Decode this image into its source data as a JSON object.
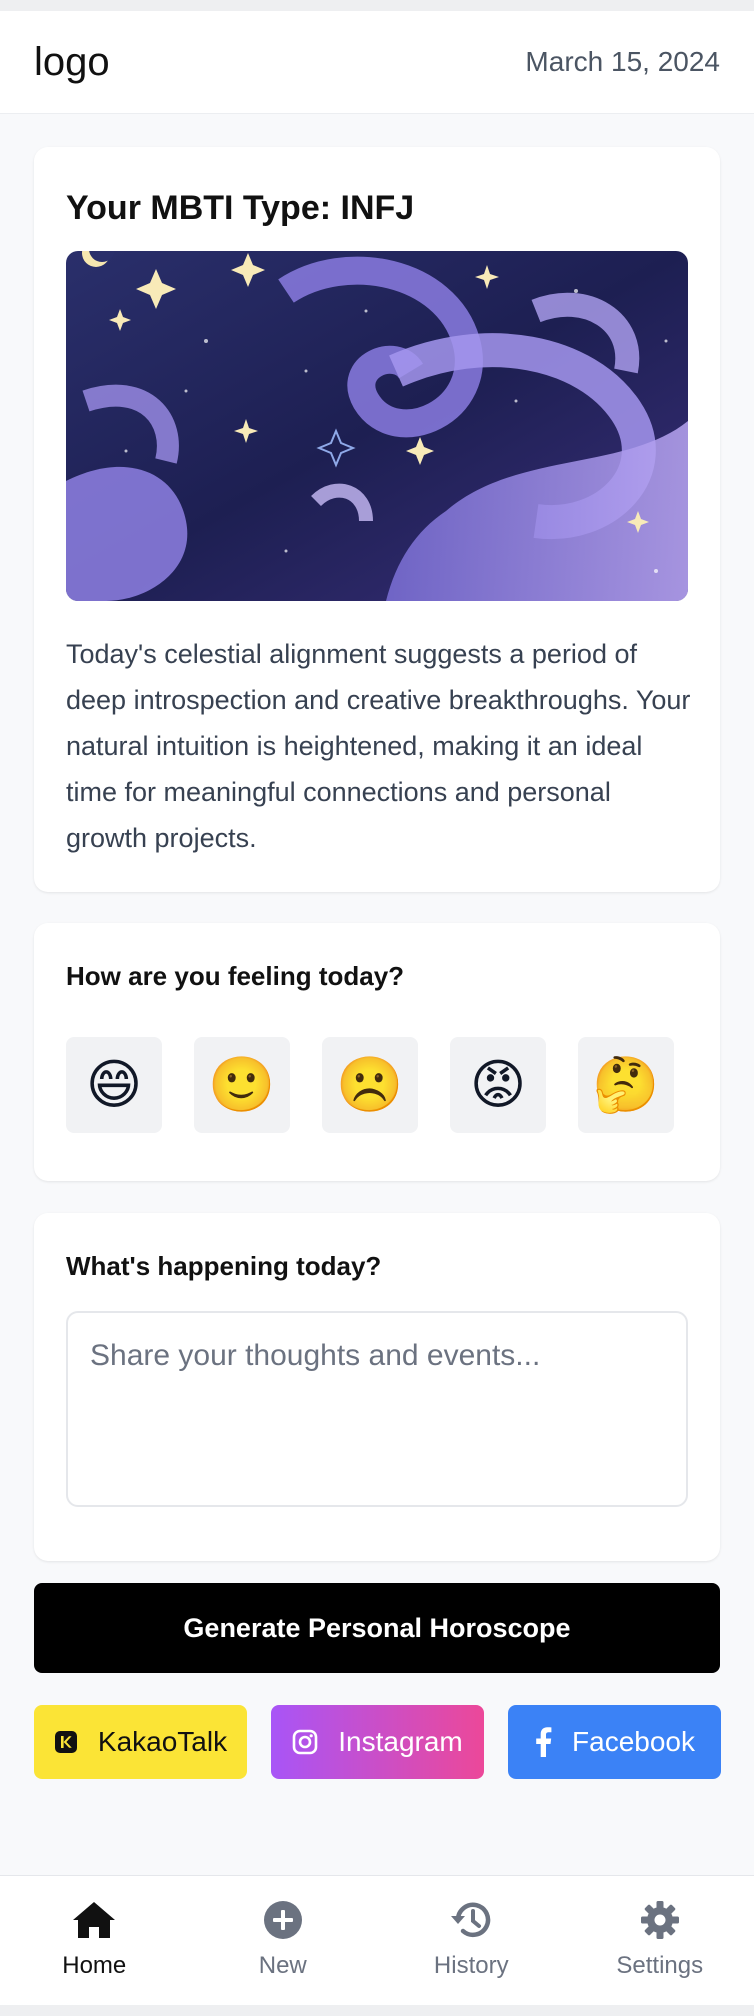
{
  "header": {
    "logo": "logo",
    "date": "March 15, 2024"
  },
  "mbti": {
    "title": "Your MBTI Type: INFJ",
    "image_alt": "celestial night sky illustration",
    "reading": "Today's celestial alignment suggests a period of deep introspection and creative breakthroughs. Your natural intuition is heightened, making it an ideal time for meaningful connections and personal growth projects."
  },
  "mood": {
    "heading": "How are you feeling today?",
    "options": [
      {
        "emoji": "😄",
        "name": "grinning-face-icon"
      },
      {
        "emoji": "🙂",
        "name": "slightly-smiling-face-icon"
      },
      {
        "emoji": "☹️",
        "name": "frowning-face-icon"
      },
      {
        "emoji": "😡",
        "name": "angry-face-icon"
      },
      {
        "emoji": "🤔",
        "name": "thinking-face-icon"
      }
    ]
  },
  "journal": {
    "heading": "What's happening today?",
    "value": "",
    "placeholder": "Share your thoughts and events..."
  },
  "actions": {
    "generate_label": "Generate Personal Horoscope"
  },
  "share": {
    "kakaotalk": "KakaoTalk",
    "instagram": "Instagram",
    "facebook": "Facebook"
  },
  "nav": {
    "home": "Home",
    "new": "New",
    "history": "History",
    "settings": "Settings",
    "active": "home"
  },
  "colors": {
    "kakao": "#fbe436",
    "instagram_start": "#a855f7",
    "instagram_end": "#ec4899",
    "facebook": "#3b82f6",
    "primary_button": "#000000"
  }
}
